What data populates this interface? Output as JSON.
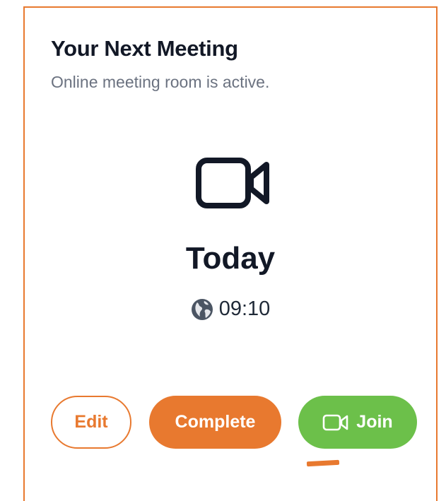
{
  "card": {
    "title": "Your Next Meeting",
    "subtitle": "Online meeting room is active.",
    "main_icon": "video-camera-icon",
    "day": "Today",
    "time_icon": "globe-icon",
    "time": "09:10"
  },
  "actions": {
    "edit_label": "Edit",
    "complete_label": "Complete",
    "join_label": "Join",
    "join_icon": "video-camera-icon"
  },
  "colors": {
    "accent_orange": "#e8792f",
    "join_green": "#6cc04a",
    "title_text": "#121826",
    "subtitle_text": "#6b7280"
  }
}
